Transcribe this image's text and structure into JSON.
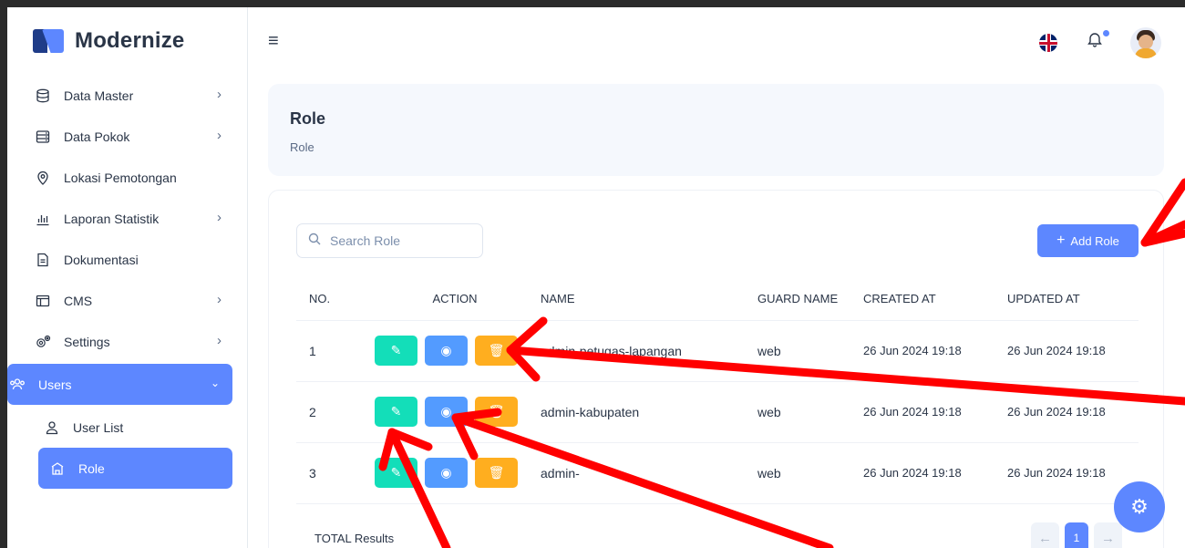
{
  "app": {
    "brand": "Modernize"
  },
  "sidebar": {
    "items": [
      {
        "label": "Data Master",
        "icon": "database-icon"
      },
      {
        "label": "Data Pokok",
        "icon": "server-icon"
      },
      {
        "label": "Lokasi Pemotongan",
        "icon": "location-pin-icon"
      },
      {
        "label": "Laporan Statistik",
        "icon": "bar-chart-icon"
      },
      {
        "label": "Dokumentasi",
        "icon": "file-text-icon"
      },
      {
        "label": "CMS",
        "icon": "layout-icon"
      },
      {
        "label": "Settings",
        "icon": "settings-icon"
      },
      {
        "label": "Users",
        "icon": "users-icon"
      },
      {
        "label": "User List",
        "icon": "user-icon"
      },
      {
        "label": "Role",
        "icon": "role-icon"
      }
    ]
  },
  "header": {
    "menu_icon": "hamburger-icon",
    "language": "English (UK)",
    "notification_icon": "bell-icon"
  },
  "breadcrumb": {
    "title": "Role",
    "sub": "Role"
  },
  "toolbar": {
    "search_placeholder": "Search Role",
    "add_label": "Add Role"
  },
  "table": {
    "headers": {
      "no": "NO.",
      "action": "ACTION",
      "name": "NAME",
      "guard": "GUARD NAME",
      "created": "CREATED AT",
      "updated": "UPDATED AT"
    },
    "rows": [
      {
        "no": "1",
        "name": "admin-petugas-lapangan",
        "guard": "web",
        "created": "26 Jun 2024 19:18",
        "updated": "26 Jun 2024 19:18"
      },
      {
        "no": "2",
        "name": "admin-kabupaten",
        "guard": "web",
        "created": "26 Jun 2024 19:18",
        "updated": "26 Jun 2024 19:18"
      },
      {
        "no": "3",
        "name": "admin-",
        "guard": "web",
        "created": "26 Jun 2024 19:18",
        "updated": "26 Jun 2024 19:18"
      }
    ]
  },
  "footer": {
    "total_label": "TOTAL Results",
    "current_page": "1"
  },
  "colors": {
    "primary": "#5d87ff",
    "edit": "#13deb9",
    "view": "#539bff",
    "delete": "#ffae1f",
    "annotation": "#ff0000"
  }
}
